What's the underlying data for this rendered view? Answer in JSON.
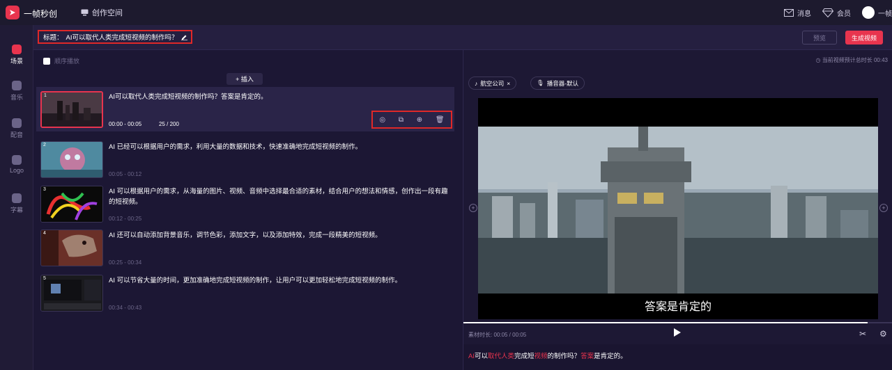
{
  "app": {
    "name": "一帧秒创",
    "workspace": "创作空间",
    "right": {
      "messages": "消息",
      "vip": "会员",
      "user": "一帧用"
    }
  },
  "nav": [
    {
      "label": "场景"
    },
    {
      "label": "音乐"
    },
    {
      "label": "配音"
    },
    {
      "label": "Logo"
    },
    {
      "label": "字幕"
    }
  ],
  "title": {
    "prefix": "标题：",
    "text": "AI可以取代人类完成短视频的制作吗？"
  },
  "buttons": {
    "preview": "预览",
    "generate": "生成视频"
  },
  "scenes_panel": {
    "order_label": "顺序播放",
    "insert": "+ 插入"
  },
  "scenes": [
    {
      "num": "1",
      "text": "AI可以取代人类完成短视频的制作吗？答案是肯定的。",
      "time": "00:00 - 00:05",
      "count": "25 / 200"
    },
    {
      "num": "2",
      "text": "AI 已经可以根据用户的需求，利用大量的数据和技术，快速准确地完成短视频的制作。",
      "time": "00:05 - 00:12"
    },
    {
      "num": "3",
      "text": "AI 可以根据用户的需求，从海量的图片、视频、音频中选择最合适的素材，结合用户的想法和情感，创作出一段有趣的短视频。",
      "time": "00:12 - 00:25"
    },
    {
      "num": "4",
      "text": "AI 还可以自动添加背景音乐，调节色彩，添加文字，以及添加特效，完成一段精美的短视频。",
      "time": "00:25 - 00:34"
    },
    {
      "num": "5",
      "text": "AI 可以节省大量的时间，更加准确地完成短视频的制作，让用户可以更加轻松地完成短视频的制作。",
      "time": "00:34 - 00:43"
    }
  ],
  "preview": {
    "duration_label": "当前视频预计总时长 00:43",
    "tags": [
      "航空公司",
      "播音器-默认"
    ],
    "subtitle": "答案是肯定的",
    "material_time": "素材时长: 00:05 / 00:05",
    "caption": {
      "p1": "AI",
      "p2": "可以",
      "p3": "取代人类",
      "p4": "完成短",
      "p5": "视频",
      "p6": "的制作吗？",
      "p7": "答案",
      "p8": "是肯定的。"
    }
  }
}
